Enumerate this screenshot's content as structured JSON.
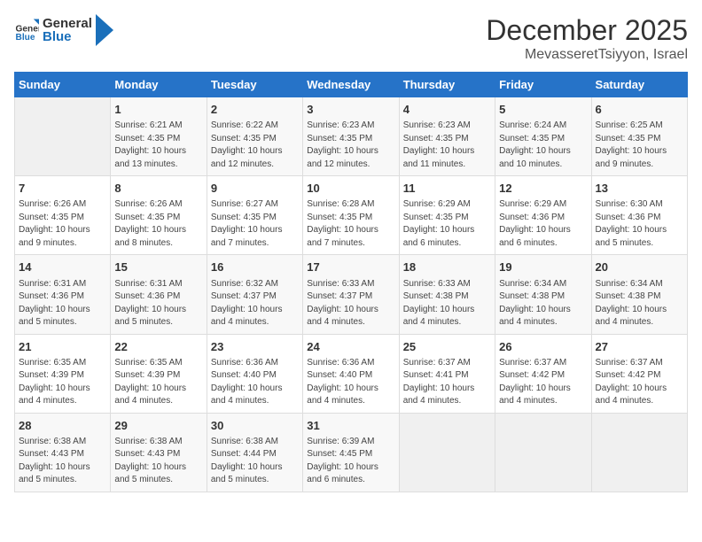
{
  "header": {
    "logo_general": "General",
    "logo_blue": "Blue",
    "title": "December 2025",
    "subtitle": "MevasseretTsiyyon, Israel"
  },
  "weekdays": [
    "Sunday",
    "Monday",
    "Tuesday",
    "Wednesday",
    "Thursday",
    "Friday",
    "Saturday"
  ],
  "weeks": [
    [
      {
        "day": "",
        "empty": true
      },
      {
        "day": "1",
        "sunrise": "6:21 AM",
        "sunset": "4:35 PM",
        "daylight": "10 hours and 13 minutes."
      },
      {
        "day": "2",
        "sunrise": "6:22 AM",
        "sunset": "4:35 PM",
        "daylight": "10 hours and 12 minutes."
      },
      {
        "day": "3",
        "sunrise": "6:23 AM",
        "sunset": "4:35 PM",
        "daylight": "10 hours and 12 minutes."
      },
      {
        "day": "4",
        "sunrise": "6:23 AM",
        "sunset": "4:35 PM",
        "daylight": "10 hours and 11 minutes."
      },
      {
        "day": "5",
        "sunrise": "6:24 AM",
        "sunset": "4:35 PM",
        "daylight": "10 hours and 10 minutes."
      },
      {
        "day": "6",
        "sunrise": "6:25 AM",
        "sunset": "4:35 PM",
        "daylight": "10 hours and 9 minutes."
      }
    ],
    [
      {
        "day": "7",
        "sunrise": "6:26 AM",
        "sunset": "4:35 PM",
        "daylight": "10 hours and 9 minutes."
      },
      {
        "day": "8",
        "sunrise": "6:26 AM",
        "sunset": "4:35 PM",
        "daylight": "10 hours and 8 minutes."
      },
      {
        "day": "9",
        "sunrise": "6:27 AM",
        "sunset": "4:35 PM",
        "daylight": "10 hours and 7 minutes."
      },
      {
        "day": "10",
        "sunrise": "6:28 AM",
        "sunset": "4:35 PM",
        "daylight": "10 hours and 7 minutes."
      },
      {
        "day": "11",
        "sunrise": "6:29 AM",
        "sunset": "4:35 PM",
        "daylight": "10 hours and 6 minutes."
      },
      {
        "day": "12",
        "sunrise": "6:29 AM",
        "sunset": "4:36 PM",
        "daylight": "10 hours and 6 minutes."
      },
      {
        "day": "13",
        "sunrise": "6:30 AM",
        "sunset": "4:36 PM",
        "daylight": "10 hours and 5 minutes."
      }
    ],
    [
      {
        "day": "14",
        "sunrise": "6:31 AM",
        "sunset": "4:36 PM",
        "daylight": "10 hours and 5 minutes."
      },
      {
        "day": "15",
        "sunrise": "6:31 AM",
        "sunset": "4:36 PM",
        "daylight": "10 hours and 5 minutes."
      },
      {
        "day": "16",
        "sunrise": "6:32 AM",
        "sunset": "4:37 PM",
        "daylight": "10 hours and 4 minutes."
      },
      {
        "day": "17",
        "sunrise": "6:33 AM",
        "sunset": "4:37 PM",
        "daylight": "10 hours and 4 minutes."
      },
      {
        "day": "18",
        "sunrise": "6:33 AM",
        "sunset": "4:38 PM",
        "daylight": "10 hours and 4 minutes."
      },
      {
        "day": "19",
        "sunrise": "6:34 AM",
        "sunset": "4:38 PM",
        "daylight": "10 hours and 4 minutes."
      },
      {
        "day": "20",
        "sunrise": "6:34 AM",
        "sunset": "4:38 PM",
        "daylight": "10 hours and 4 minutes."
      }
    ],
    [
      {
        "day": "21",
        "sunrise": "6:35 AM",
        "sunset": "4:39 PM",
        "daylight": "10 hours and 4 minutes."
      },
      {
        "day": "22",
        "sunrise": "6:35 AM",
        "sunset": "4:39 PM",
        "daylight": "10 hours and 4 minutes."
      },
      {
        "day": "23",
        "sunrise": "6:36 AM",
        "sunset": "4:40 PM",
        "daylight": "10 hours and 4 minutes."
      },
      {
        "day": "24",
        "sunrise": "6:36 AM",
        "sunset": "4:40 PM",
        "daylight": "10 hours and 4 minutes."
      },
      {
        "day": "25",
        "sunrise": "6:37 AM",
        "sunset": "4:41 PM",
        "daylight": "10 hours and 4 minutes."
      },
      {
        "day": "26",
        "sunrise": "6:37 AM",
        "sunset": "4:42 PM",
        "daylight": "10 hours and 4 minutes."
      },
      {
        "day": "27",
        "sunrise": "6:37 AM",
        "sunset": "4:42 PM",
        "daylight": "10 hours and 4 minutes."
      }
    ],
    [
      {
        "day": "28",
        "sunrise": "6:38 AM",
        "sunset": "4:43 PM",
        "daylight": "10 hours and 5 minutes."
      },
      {
        "day": "29",
        "sunrise": "6:38 AM",
        "sunset": "4:43 PM",
        "daylight": "10 hours and 5 minutes."
      },
      {
        "day": "30",
        "sunrise": "6:38 AM",
        "sunset": "4:44 PM",
        "daylight": "10 hours and 5 minutes."
      },
      {
        "day": "31",
        "sunrise": "6:39 AM",
        "sunset": "4:45 PM",
        "daylight": "10 hours and 6 minutes."
      },
      {
        "day": "",
        "empty": true
      },
      {
        "day": "",
        "empty": true
      },
      {
        "day": "",
        "empty": true
      }
    ]
  ],
  "labels": {
    "sunrise_prefix": "Sunrise:",
    "sunset_prefix": "Sunset:",
    "daylight_prefix": "Daylight:"
  }
}
